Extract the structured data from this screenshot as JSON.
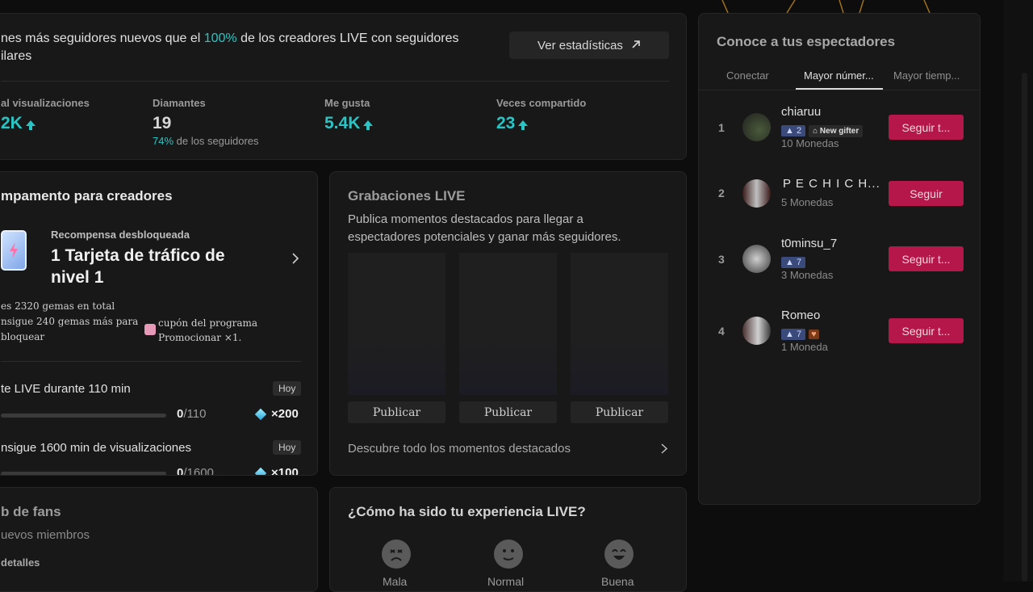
{
  "stats_card": {
    "summary_pre": "nes más seguidores nuevos que el ",
    "summary_pct": "100%",
    "summary_post": " de los creadores LIVE con seguidores",
    "summary_line2": "ilares",
    "stats_button": "Ver estadísticas",
    "metrics": [
      {
        "label": "al visualizaciones",
        "value": "2K",
        "sub_pct": "",
        "sub_text": ""
      },
      {
        "label": "Diamantes",
        "value": "19",
        "sub_pct": "74%",
        "sub_text": " de los seguidores"
      },
      {
        "label": "Me gusta",
        "value": "5.4K",
        "sub_pct": "",
        "sub_text": ""
      },
      {
        "label": "Veces compartido",
        "value": "23",
        "sub_pct": "",
        "sub_text": ""
      }
    ]
  },
  "camp": {
    "title": "mpamento para creadores",
    "reward_label": "Recompensa desbloqueada",
    "reward_title": "1 Tarjeta de tráfico de nivel 1",
    "gems_line1": "es 2320 gemas en total",
    "gems_line2": "nsigue 240 gemas más para",
    "gems_line3": "bloquear",
    "coupon_line1": "cupón del programa",
    "coupon_line2": "Promocionar ×1.",
    "tasks": [
      {
        "title": "te LIVE durante 110 min",
        "badge": "Hoy",
        "progress_done": "0",
        "progress_total": "/110",
        "reward": "×200",
        "fraction": 0
      },
      {
        "title": "nsigue 1600 min de visualizaciones",
        "badge": "Hoy",
        "progress_done": "0",
        "progress_total": "/1600",
        "reward": "×100",
        "fraction": 0
      }
    ]
  },
  "recordings": {
    "title": "Grabaciones LIVE",
    "desc_line1": "Publica momentos destacados para llegar a",
    "desc_line2": "espectadores potenciales y ganar más seguidores.",
    "publish_label": "Publicar",
    "discover": "Descubre todo los momentos destacados"
  },
  "fans": {
    "title": "b de fans",
    "subtitle": "uevos miembros",
    "details": "detalles"
  },
  "experience": {
    "title": "¿Cómo ha sido tu experiencia LIVE?",
    "options": [
      "Mala",
      "Normal",
      "Buena"
    ]
  },
  "viewers": {
    "title": "Conoce a tus espectadores",
    "tabs": [
      "Conectar",
      "Mayor númer...",
      "Mayor tiemp..."
    ],
    "active_tab": 1,
    "list": [
      {
        "rank": "1",
        "name": "chiaruu",
        "level": "2",
        "extra": "New gifter",
        "coins": "10 Monedas",
        "button": "Seguir t..."
      },
      {
        "rank": "2",
        "name": "P E C H I C H...",
        "level": "",
        "extra": "",
        "coins": "5 Monedas",
        "button": "Seguir"
      },
      {
        "rank": "3",
        "name": "t0minsu_7",
        "level": "7",
        "extra": "",
        "coins": "3 Monedas",
        "button": "Seguir t..."
      },
      {
        "rank": "4",
        "name": "Romeo",
        "level": "7",
        "extra": "",
        "coins": "1 Moneda",
        "button": "Seguir t..."
      }
    ]
  },
  "colors": {
    "accent_teal": "#2bc4c4",
    "follow_pink": "#b5174a",
    "background": "#0d0d0d",
    "card": "#181818"
  }
}
